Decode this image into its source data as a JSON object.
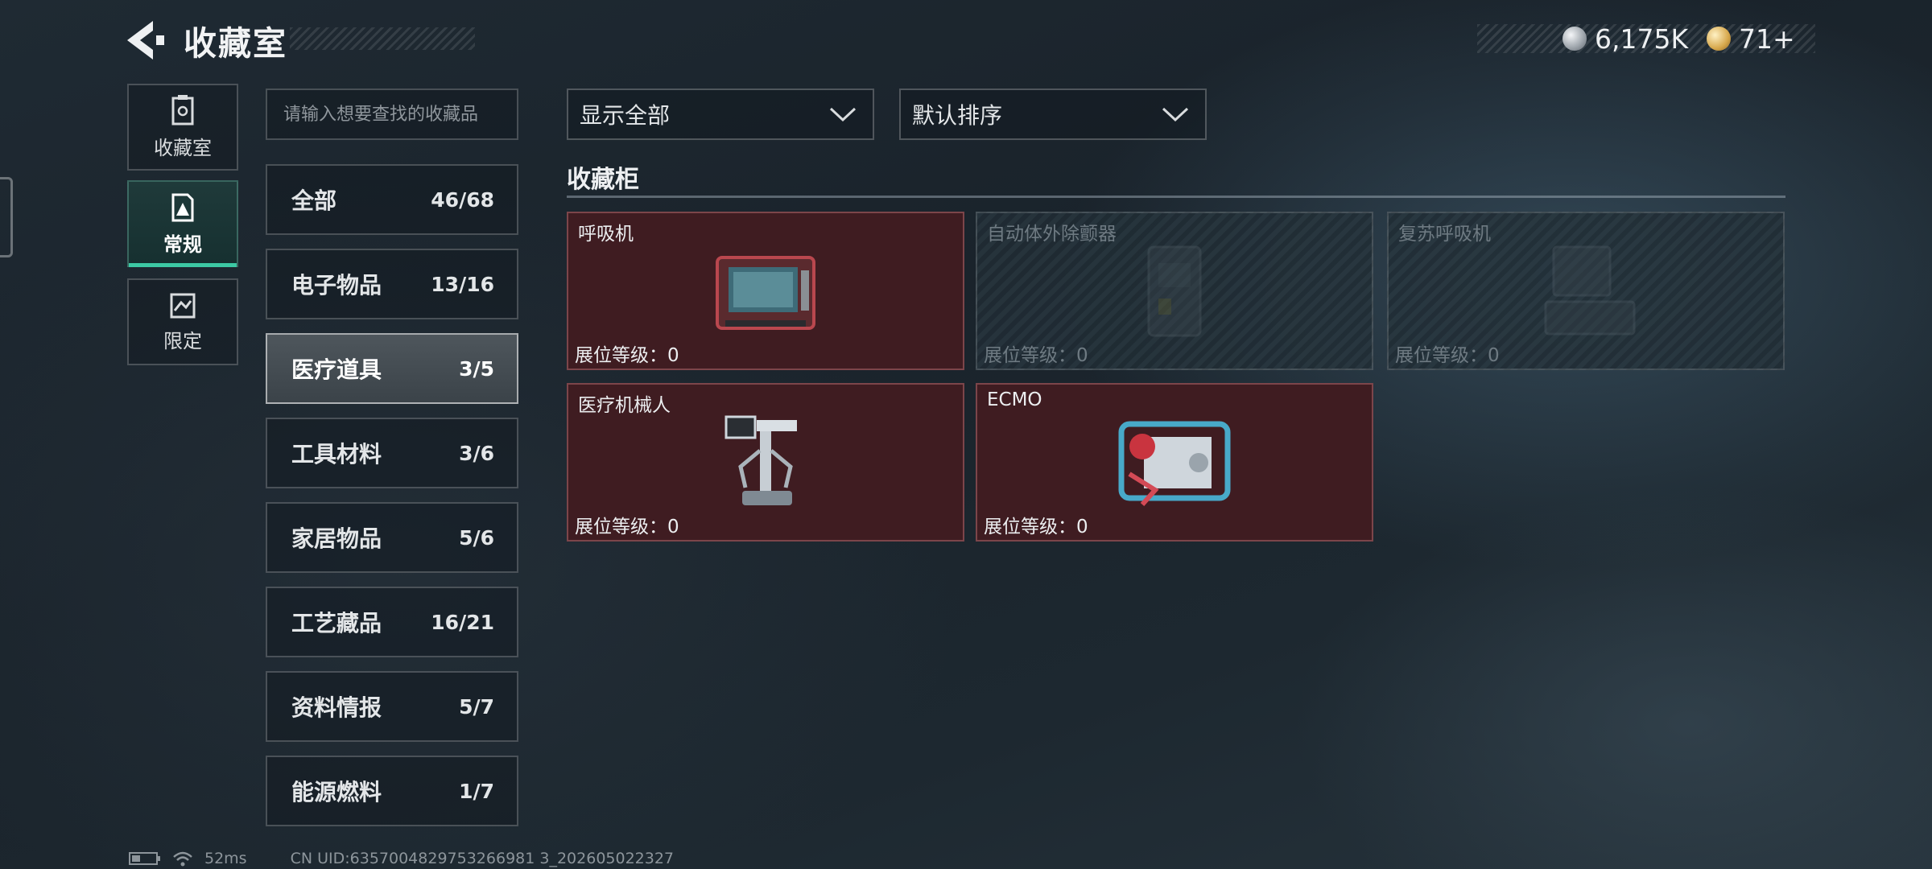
{
  "header": {
    "title": "收藏室",
    "currency": [
      {
        "icon": "silver-coin-icon",
        "value": "6,175K"
      },
      {
        "icon": "gold-coin-icon",
        "value": "71+"
      }
    ]
  },
  "side_tabs": [
    {
      "label": "收藏室",
      "icon": "collection-room-icon"
    },
    {
      "label": "常规",
      "icon": "regular-icon",
      "active": true
    },
    {
      "label": "限定",
      "icon": "limited-icon"
    }
  ],
  "search": {
    "placeholder": "请输入想要查找的收藏品"
  },
  "categories": [
    {
      "name": "全部",
      "count": "46/68"
    },
    {
      "name": "电子物品",
      "count": "13/16"
    },
    {
      "name": "医疗道具",
      "count": "3/5",
      "active": true
    },
    {
      "name": "工具材料",
      "count": "3/6"
    },
    {
      "name": "家居物品",
      "count": "5/6"
    },
    {
      "name": "工艺藏品",
      "count": "16/21"
    },
    {
      "name": "资料情报",
      "count": "5/7"
    },
    {
      "name": "能源燃料",
      "count": "1/7"
    }
  ],
  "filters": {
    "filter": {
      "value": "显示全部"
    },
    "sort": {
      "value": "默认排序"
    }
  },
  "section": {
    "title": "收藏柜"
  },
  "items": [
    {
      "name": "呼吸机",
      "level": "展位等级：0",
      "owned": true,
      "icon": "ventilator-icon"
    },
    {
      "name": "自动体外除颤器",
      "level": "展位等级：0",
      "owned": false,
      "icon": "defibrillator-icon"
    },
    {
      "name": "复苏呼吸机",
      "level": "展位等级：0",
      "owned": false,
      "icon": "resuscitator-icon"
    },
    {
      "name": "医疗机械人",
      "level": "展位等级：0",
      "owned": true,
      "icon": "medical-robot-icon"
    },
    {
      "name": "ECMO",
      "level": "展位等级：0",
      "owned": true,
      "icon": "ecmo-icon"
    }
  ],
  "footer": {
    "ping": "52ms",
    "uid": "CN UID:6357004829753266981 3_202605022327"
  },
  "colors": {
    "accent_teal": "#3cc9a4",
    "owned_card": "#3f1c21",
    "background": "#1d2830"
  }
}
